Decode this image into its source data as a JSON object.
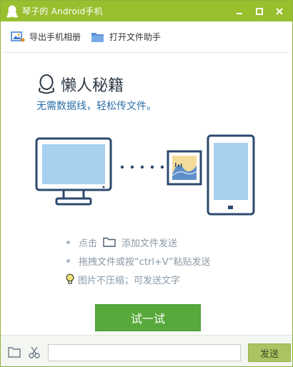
{
  "window": {
    "title": "琴子的 Android手机"
  },
  "titlebar": {
    "minimize": "▬",
    "maximize": "■",
    "close": "✕"
  },
  "toolbar": {
    "export_album": "导出手机相册",
    "open_file_helper": "打开文件助手"
  },
  "main": {
    "heading": "懒人秘籍",
    "subtitle": "无需数据线，轻松传文件。",
    "tips": {
      "click": "点击",
      "add_file": "添加文件发送",
      "drag": "拖拽文件或按“ctrl+V”粘贴发送",
      "image": "图片不压缩；可发送文字"
    },
    "try_button": "试一试"
  },
  "bottom": {
    "input_value": "",
    "send_label": "发送"
  },
  "colors": {
    "titlebar": "#98bf2e",
    "try_button": "#57a93b",
    "send_button": "#aac463",
    "device_outline": "#2c4a6e",
    "screen": "#a8d0ef"
  }
}
